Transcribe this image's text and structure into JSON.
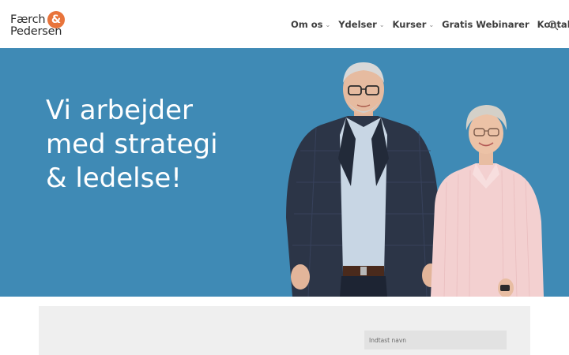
{
  "logo": {
    "line1": "Færch",
    "line2": "Pedersen",
    "ampersand": "&",
    "accent_color": "#e8743b"
  },
  "nav": {
    "items": [
      {
        "label": "Om os",
        "has_dropdown": true
      },
      {
        "label": "Ydelser",
        "has_dropdown": true
      },
      {
        "label": "Kurser",
        "has_dropdown": true
      },
      {
        "label": "Gratis Webinarer",
        "has_dropdown": false
      },
      {
        "label": "Kontakt",
        "has_dropdown": false
      }
    ],
    "dropdown_glyph": "⌄",
    "search_icon": "search-icon"
  },
  "hero": {
    "title_line1": "Vi arbejder",
    "title_line2": "med strategi",
    "title_line3": "& ledelse!",
    "background_color": "#3f8ab5"
  },
  "form": {
    "name_placeholder": "Indtast navn",
    "name_value": ""
  }
}
